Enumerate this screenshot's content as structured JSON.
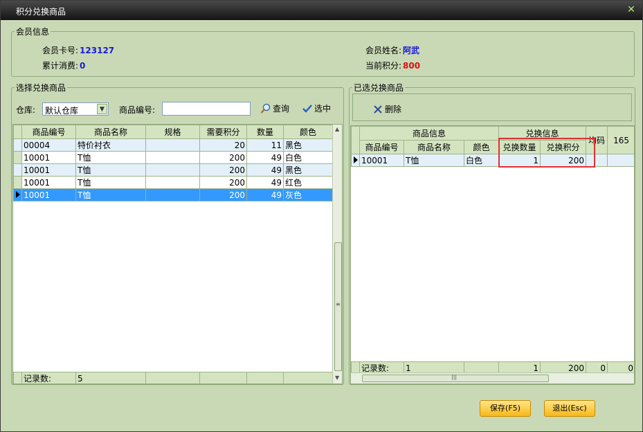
{
  "window": {
    "title": "积分兑换商品",
    "close_label": "✕"
  },
  "member": {
    "legend": "会员信息",
    "card_label": "会员卡号:",
    "card_value": "123127",
    "total_label": "累计消费:",
    "total_value": "0",
    "name_label": "会员姓名:",
    "name_value": "阿武",
    "points_label": "当前积分:",
    "points_value": "800"
  },
  "left": {
    "legend": "选择兑换商品",
    "warehouse_label": "仓库:",
    "warehouse_value": "默认仓库",
    "code_label": "商品编号:",
    "code_value": "",
    "query_label": "查询",
    "select_label": "选中",
    "columns": [
      "商品编号",
      "商品名称",
      "规格",
      "需要积分",
      "数量",
      "颜色"
    ],
    "rows": [
      [
        "00004",
        "特价衬衣",
        "",
        "20",
        "11",
        "黑色"
      ],
      [
        "10001",
        "T恤",
        "",
        "200",
        "49",
        "白色"
      ],
      [
        "10001",
        "T恤",
        "",
        "200",
        "49",
        "黑色"
      ],
      [
        "10001",
        "T恤",
        "",
        "200",
        "49",
        "红色"
      ],
      [
        "10001",
        "T恤",
        "",
        "200",
        "49",
        "灰色"
      ]
    ],
    "footer_label": "记录数:",
    "footer_count": "5",
    "scroll_grip": "≡"
  },
  "right": {
    "legend": "已选兑换商品",
    "delete_label": "删除",
    "group1": "商品信息",
    "group2": "兑换信息",
    "col_extra1": "均码",
    "col_extra2": "165",
    "columns": [
      "商品编号",
      "商品名称",
      "颜色",
      "兑换数量",
      "兑换积分"
    ],
    "rows": [
      [
        "10001",
        "T恤",
        "白色",
        "1",
        "200"
      ]
    ],
    "footer_label": "记录数:",
    "footer_values": [
      "1",
      "",
      "",
      "1",
      "200",
      "0",
      "0"
    ],
    "scroll_grip": "|||"
  },
  "buttons": {
    "save": "保存(F5)",
    "exit": "退出(Esc)"
  },
  "colors": {
    "background": "#c9d9b6",
    "selected_row": "#3399ff",
    "highlight": "#e03030",
    "button": "#f7b818"
  }
}
